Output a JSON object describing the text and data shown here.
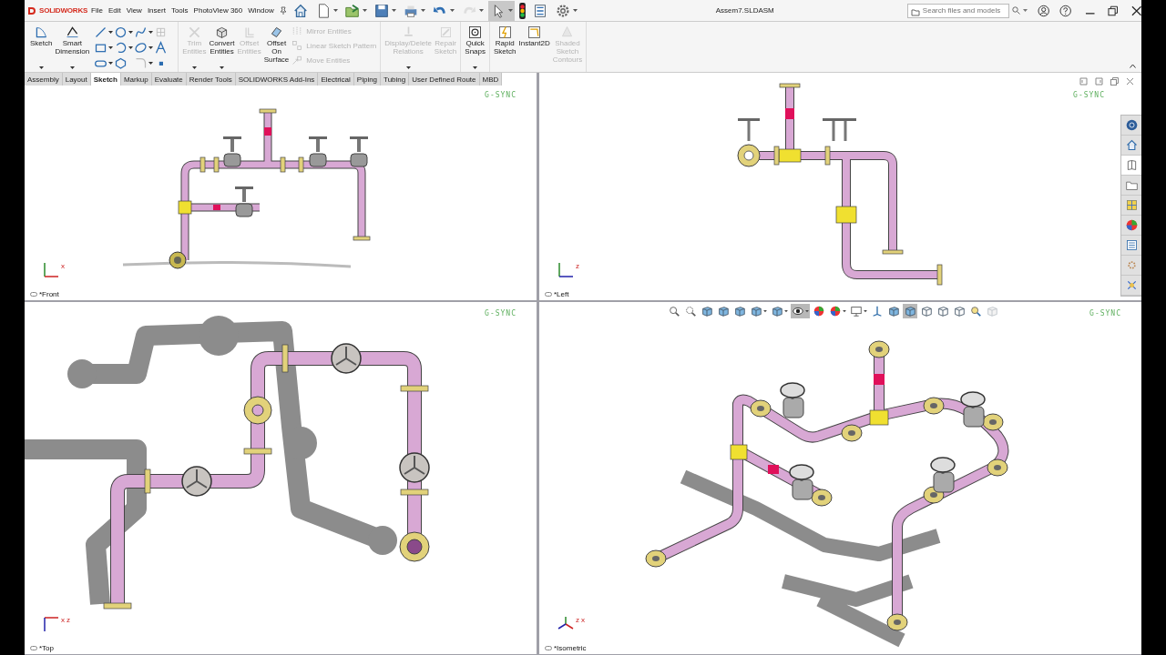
{
  "app": {
    "logo": "SOLIDWORKS",
    "menus": [
      "File",
      "Edit",
      "View",
      "Insert",
      "Tools",
      "PhotoView 360",
      "Window"
    ],
    "document_title": "Assem7.SLDASM",
    "search": {
      "placeholder": "Search files and models"
    }
  },
  "quick_access_tools": [
    {
      "selected": false,
      "disabled": false
    },
    {
      "selected": false,
      "disabled": false
    },
    {
      "selected": false,
      "disabled": false
    },
    {
      "selected": false,
      "disabled": false
    },
    {
      "selected": false,
      "disabled": false
    },
    {
      "selected": false,
      "disabled": false
    },
    {
      "selected": false,
      "disabled": true
    },
    {
      "selected": true,
      "disabled": false
    },
    {
      "selected": false,
      "disabled": false
    },
    {
      "selected": false,
      "disabled": false
    },
    {
      "selected": false,
      "disabled": false
    }
  ],
  "ribbon": {
    "groups": [
      {
        "commands": [
          {
            "label": "Sketch",
            "disabled": false,
            "dropdown": true
          },
          {
            "label": "Smart Dimension",
            "disabled": false,
            "dropdown": true
          }
        ]
      },
      {
        "commands": [
          {
            "label": "Trim Entities",
            "disabled": true,
            "dropdown": true
          },
          {
            "label": "Convert Entities",
            "disabled": false,
            "dropdown": true
          },
          {
            "label": "Offset Entities",
            "disabled": true,
            "dropdown": false
          },
          {
            "label": "Offset On Surface",
            "disabled": false,
            "dropdown": false
          }
        ],
        "stack": [
          {
            "label": "Mirror Entities",
            "disabled": true
          },
          {
            "label": "Linear Sketch Pattern",
            "disabled": true
          },
          {
            "label": "Move Entities",
            "disabled": true
          }
        ]
      },
      {
        "commands": [
          {
            "label": "Display/Delete Relations",
            "disabled": true,
            "dropdown": true
          },
          {
            "label": "Repair Sketch",
            "disabled": true,
            "dropdown": false
          }
        ]
      },
      {
        "commands": [
          {
            "label": "Quick Snaps",
            "disabled": false,
            "dropdown": true
          }
        ]
      },
      {
        "commands": [
          {
            "label": "Rapid Sketch",
            "disabled": false,
            "dropdown": false
          },
          {
            "label": "Instant2D",
            "disabled": false,
            "dropdown": false
          },
          {
            "label": "Shaded Sketch Contours",
            "disabled": true,
            "dropdown": false
          }
        ]
      }
    ]
  },
  "tabs": [
    {
      "label": "Assembly",
      "selected": false
    },
    {
      "label": "Layout",
      "selected": false
    },
    {
      "label": "Sketch",
      "selected": true
    },
    {
      "label": "Markup",
      "selected": false
    },
    {
      "label": "Evaluate",
      "selected": false
    },
    {
      "label": "Render Tools",
      "selected": false
    },
    {
      "label": "SOLIDWORKS Add-Ins",
      "selected": false
    },
    {
      "label": "Electrical",
      "selected": false
    },
    {
      "label": "Piping",
      "selected": false
    },
    {
      "label": "Tubing",
      "selected": false
    },
    {
      "label": "User Defined Route",
      "selected": false
    },
    {
      "label": "MBD",
      "selected": false
    }
  ],
  "viewports": [
    {
      "kind": "front",
      "label": "*Front",
      "overlay": "G-SYNC",
      "axis_labels": [
        "x"
      ]
    },
    {
      "kind": "left",
      "label": "*Left",
      "overlay": "G-SYNC",
      "axis_labels": [
        "z"
      ]
    },
    {
      "kind": "top",
      "label": "*Top",
      "overlay": "G-SYNC",
      "axis_labels": [
        "x",
        "z"
      ]
    },
    {
      "kind": "isometric",
      "label": "*Isometric",
      "overlay": "G-SYNC",
      "axis_labels": [
        "z",
        "x"
      ]
    }
  ],
  "heads_up_toolbar": [
    {
      "selected": false,
      "disabled": false
    },
    {
      "selected": false,
      "disabled": false
    },
    {
      "selected": false,
      "disabled": false
    },
    {
      "selected": false,
      "disabled": false
    },
    {
      "selected": false,
      "disabled": false
    },
    {
      "selected": false,
      "disabled": false
    },
    {
      "selected": false,
      "disabled": false
    },
    {
      "selected": true,
      "disabled": false
    },
    {
      "selected": false,
      "disabled": false
    },
    {
      "selected": false,
      "disabled": false
    },
    {
      "selected": false,
      "disabled": false
    },
    {
      "selected": false,
      "disabled": false
    },
    {
      "selected": false,
      "disabled": false
    },
    {
      "selected": true,
      "disabled": false
    },
    {
      "selected": false,
      "disabled": false
    },
    {
      "selected": false,
      "disabled": false
    },
    {
      "selected": false,
      "disabled": false
    },
    {
      "selected": false,
      "disabled": false
    },
    {
      "selected": false,
      "disabled": true
    }
  ],
  "task_pane": [
    {
      "selected": false
    },
    {
      "selected": false
    },
    {
      "selected": true
    },
    {
      "selected": false
    },
    {
      "selected": false
    },
    {
      "selected": false
    },
    {
      "selected": false
    },
    {
      "selected": false
    },
    {
      "selected": false
    }
  ]
}
